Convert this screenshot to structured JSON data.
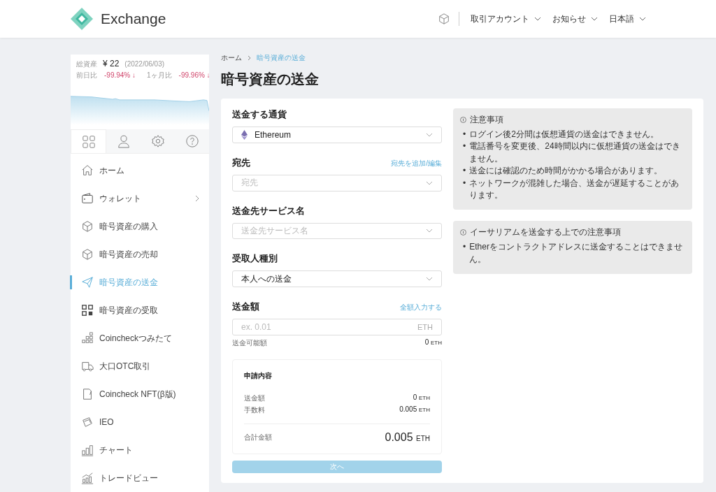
{
  "header": {
    "brand": "Exchange",
    "menus": [
      {
        "label": "取引アカウント"
      },
      {
        "label": "お知らせ"
      },
      {
        "label": "日本語"
      }
    ]
  },
  "sidebar": {
    "summary": {
      "total_label": "総資産",
      "total": "¥ 22",
      "date": "(2022/06/03)",
      "changes": [
        {
          "label": "前日比",
          "value": "-99.94% ↓"
        },
        {
          "label": "1ヶ月比",
          "value": "-99.96% ↓"
        }
      ]
    },
    "tabs": [
      {
        "selected": true
      },
      {
        "selected": false
      },
      {
        "selected": false
      },
      {
        "selected": false
      }
    ],
    "items": [
      {
        "label": "ホーム",
        "selected": false,
        "submenu": false
      },
      {
        "label": "ウォレット",
        "selected": false,
        "submenu": true
      },
      {
        "label": "暗号資産の購入",
        "selected": false,
        "submenu": false
      },
      {
        "label": "暗号資産の売却",
        "selected": false,
        "submenu": false
      },
      {
        "label": "暗号資産の送金",
        "selected": true,
        "submenu": false
      },
      {
        "label": "暗号資産の受取",
        "selected": false,
        "submenu": false
      },
      {
        "label": "Coincheckつみたて",
        "selected": false,
        "submenu": false
      },
      {
        "label": "大口OTC取引",
        "selected": false,
        "submenu": false
      },
      {
        "label": "Coincheck NFT(β版)",
        "selected": false,
        "submenu": false
      },
      {
        "label": "IEO",
        "selected": false,
        "submenu": false
      },
      {
        "label": "チャート",
        "selected": false,
        "submenu": false
      },
      {
        "label": "トレードビュー",
        "selected": false,
        "submenu": false
      }
    ]
  },
  "breadcrumb": [
    {
      "label": "ホーム",
      "current": false
    },
    {
      "label": "暗号資産の送金",
      "current": true
    }
  ],
  "page_title": "暗号資産の送金",
  "form": {
    "fields": [
      {
        "kind": "currency",
        "label": "送金する通貨",
        "value": "Ethereum"
      },
      {
        "kind": "select",
        "label": "宛先",
        "link": "宛先を追加/編集",
        "placeholder": "宛先"
      },
      {
        "kind": "select",
        "label": "送金先サービス名",
        "placeholder": "送金先サービス名"
      },
      {
        "kind": "select",
        "label": "受取人種別",
        "value": "本人への送金"
      },
      {
        "kind": "input",
        "label": "送金額",
        "link": "全額入力する",
        "placeholder": "ex. 0.01",
        "unit": "ETH"
      }
    ],
    "available": {
      "label": "送金可能額",
      "amount": "0",
      "unit": "ETH"
    },
    "summary": {
      "title": "申請内容",
      "rows": [
        {
          "label": "送金額",
          "amount": "0",
          "unit": "ETH"
        },
        {
          "label": "手数料",
          "amount": "0.005",
          "unit": "ETH"
        }
      ],
      "total": {
        "label": "合計金額",
        "amount": "0.005",
        "unit": "ETH"
      }
    },
    "submit": {
      "label": "次へ",
      "disabled": true
    }
  },
  "notices": [
    {
      "title": "注意事項",
      "marker": "•",
      "bullets": [
        "ログイン後2分間は仮想通貨の送金はできません。",
        "電話番号を変更後、24時間以内に仮想通貨の送金はできません。",
        "送金には確認のため時間がかかる場合があります。",
        "ネットワークが混雑した場合、送金が遅延することがあります。"
      ]
    },
    {
      "title": "イーサリアムを送金する上での注意事項",
      "marker": "•",
      "bullets": [
        "Etherをコントラクトアドレスに送金することはできません。"
      ]
    }
  ]
}
